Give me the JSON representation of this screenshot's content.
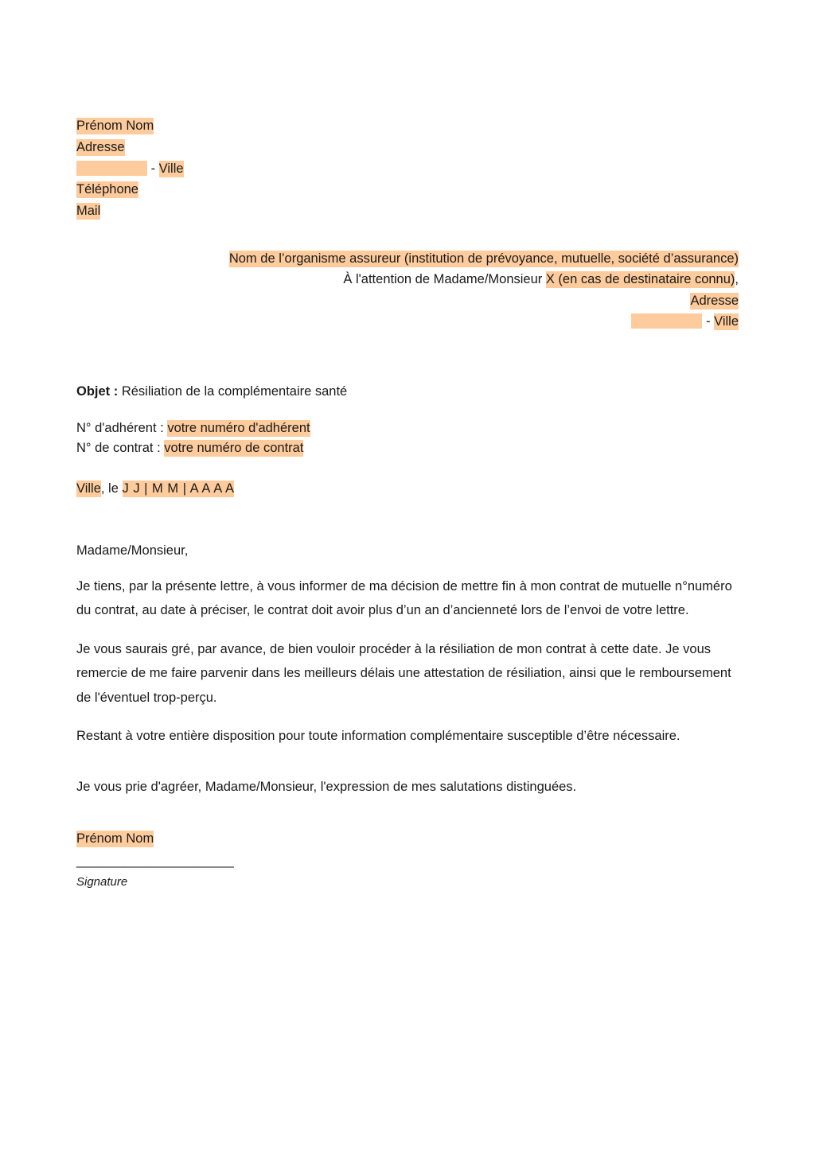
{
  "document": {
    "title": "Lettre de résiliation de la complémentaire santé",
    "highlight_color": "#fdcb9c",
    "text_color": "#1a1a1a",
    "background_color": "#ffffff"
  },
  "sender": {
    "name": "Prénom Nom",
    "address": "Adresse",
    "postal_code_placeholder": "",
    "city_separator": " - ",
    "city": "Ville",
    "phone": "Téléphone",
    "email": "Mail"
  },
  "recipient": {
    "organisation": "Nom de l’organisme assureur (institution de prévoyance, mutuelle, société d’assurance)",
    "attention_prefix": "À l'attention de Madame/Monsieur ",
    "attention_placeholder": "X (en cas de destinataire connu)",
    "attention_suffix": ",",
    "address": "Adresse",
    "postal_code_placeholder": "",
    "city_separator": " - ",
    "city": "Ville"
  },
  "subject": {
    "label": "Objet :",
    "value": " Résiliation de la complémentaire santé"
  },
  "references": {
    "member_label": "N° d'adhérent : ",
    "member_value": "votre numéro d'adhérent",
    "contract_label": "N° de contrat : ",
    "contract_value": "votre numéro de contrat"
  },
  "dateline": {
    "city": "Ville",
    "separator": ", le ",
    "date_fields": " J  J  |  M M  |  A  A  A  A "
  },
  "letter": {
    "salutation": "Madame/Monsieur,",
    "paragraph_1": "Je tiens, par la présente lettre, à vous informer de ma décision de mettre fin à mon contrat de mutuelle n°numéro du contrat, au date à préciser, le contrat doit avoir plus d’un an d’ancienneté lors de l’envoi de votre lettre.",
    "paragraph_2": "Je vous saurais gré, par avance, de bien vouloir procéder à la résiliation de mon contrat à cette date. Je vous remercie de me faire parvenir dans les meilleurs délais une attestation de résiliation, ainsi que le remboursement de l'éventuel trop-perçu.",
    "paragraph_3": "Restant à votre entière disposition pour toute information complémentaire susceptible d’être nécessaire.",
    "closing": "Je vous prie d'agréer, Madame/Monsieur, l'expression de mes salutations distinguées."
  },
  "signature": {
    "name": "Prénom Nom",
    "rule": "_______________________",
    "label": "Signature"
  }
}
